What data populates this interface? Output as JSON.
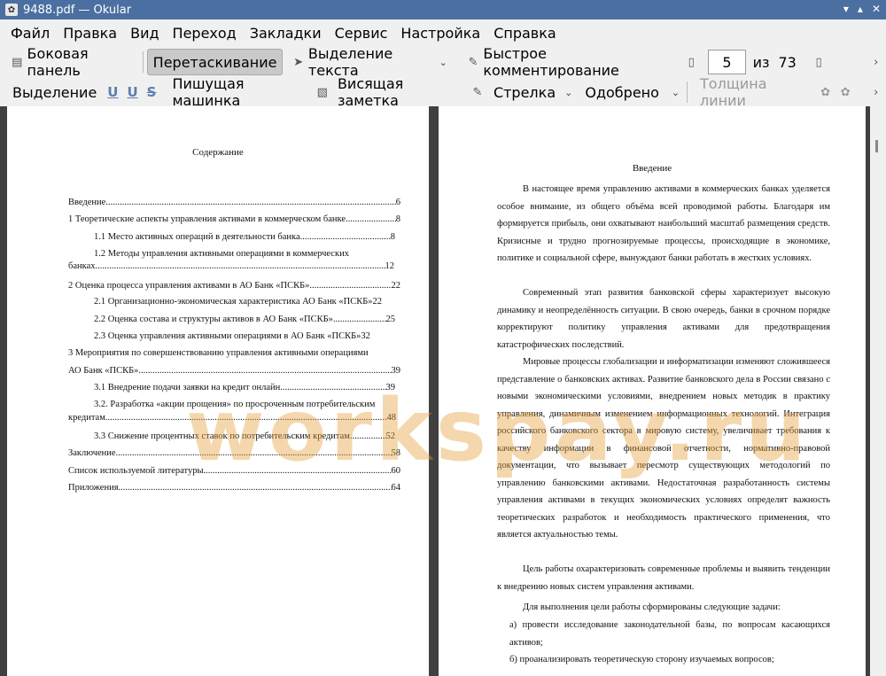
{
  "window": {
    "title": "9488.pdf — Okular"
  },
  "menu": [
    "Файл",
    "Правка",
    "Вид",
    "Переход",
    "Закладки",
    "Сервис",
    "Настройка",
    "Справка"
  ],
  "toolbar1": {
    "sidebar_label": "Боковая панель",
    "drag_label": "Перетаскивание",
    "text_select_label": "Выделение текста",
    "quick_annot_label": "Быстрое комментирование",
    "page_current": "5",
    "page_of": "из",
    "page_total": "73"
  },
  "toolbar2": {
    "highlight_label": "Выделение",
    "typewriter_label": "Пишущая машинка",
    "popup_note_label": "Висящая заметка",
    "arrow_label": "Стрелка",
    "stamp_label": "Одобрено",
    "line_width_label": "Толщина линии"
  },
  "left_page": {
    "title": "Содержание",
    "toc": [
      {
        "text": "Введение",
        "page": "6"
      },
      {
        "text": "1 Теоретические аспекты управления активами в коммерческом банке",
        "page": "8"
      },
      {
        "text": "1.1 Место активных операций в деятельности банка",
        "page": "8"
      },
      {
        "text": "1.2 Методы управления активными операциями в коммерческих",
        "page": ""
      },
      {
        "text": "банках",
        "page": "12"
      },
      {
        "text": "2 Оценка процесса управления активами в АО Банк «ПСКБ»",
        "page": "22"
      },
      {
        "text": "2.1 Организационно-экономическая характеристика АО Банк «ПСКБ»",
        "page": "22"
      },
      {
        "text": "2.2 Оценка состава и структуры активов в АО Банк «ПСКБ»",
        "page": "25"
      },
      {
        "text": "2.3 Оценка управления активными операциями в АО Банк «ПСКБ»",
        "page": "32"
      },
      {
        "text": "3 Мероприятия по совершенствованию управления активными операциями",
        "page": ""
      },
      {
        "text": "АО Банк «ПСКБ»",
        "page": "39"
      },
      {
        "text": "3.1 Внедрение подачи заявки на кредит онлайн",
        "page": "39"
      },
      {
        "text": "3.2. Разработка «акции прощения» по просроченным потребительским",
        "page": ""
      },
      {
        "text": "кредитам",
        "page": "48"
      },
      {
        "text": "3.3 Снижение процентных ставок по потребительским кредитам",
        "page": "52"
      },
      {
        "text": "Заключение",
        "page": "58"
      },
      {
        "text": "Список используемой литературы",
        "page": "60"
      },
      {
        "text": "Приложения",
        "page": "64"
      }
    ]
  },
  "right_page": {
    "title": "Введение",
    "paragraphs": [
      "В настоящее время управлению активами в коммерческих банках уделяется особое внимание, из общего объёма всей проводимой работы. Благодаря им формируется прибыль, они охватывают наибольший масштаб размещения средств. Кризисные и трудно прогнозируемые процессы, происходящие в экономике, политике и социальной сфере, вынуждают банки работать в жестких условиях.",
      "Современный этап развития банковской сферы характеризует высокую динамику и неопределённость ситуации. В свою очередь, банки в срочном порядке корректируют политику управления активами для предотвращения катастрофических последствий.",
      "Мировые процессы глобализации и информатизации изменяют сложившееся представление о банковских активах. Развитие банковского дела в России связано с новыми экономическими условиями, внедрением новых методик в практику управления, динамичным изменением информационных технологий. Интеграция российского банковского сектора в мировую систему, увеличивает требования к качеству информации в финансовой отчетности, нормативно-правовой документации, что вызывает пересмотр существующих методологий по управлению банковскими активами. Недостаточная разработанность системы управления активами в текущих экономических условиях определят важность теоретических разработок и необходимость практического применения, что является актуальностью темы.",
      "Цель работы охарактеризовать современные проблемы и выявить тенденции к внедрению новых систем управления активами.",
      "Для выполнения цели работы сформированы следующие задачи:",
      "а)  провести исследование законодательной базы, по вопросам касающихся активов;",
      "б)  проанализировать теоретическую сторону изучаемых вопросов;"
    ]
  },
  "watermark": "workspay.ru",
  "colors": {
    "titlebar": "#4b6fa0",
    "doc_background": "#404040",
    "watermark": "#e6a03c"
  }
}
